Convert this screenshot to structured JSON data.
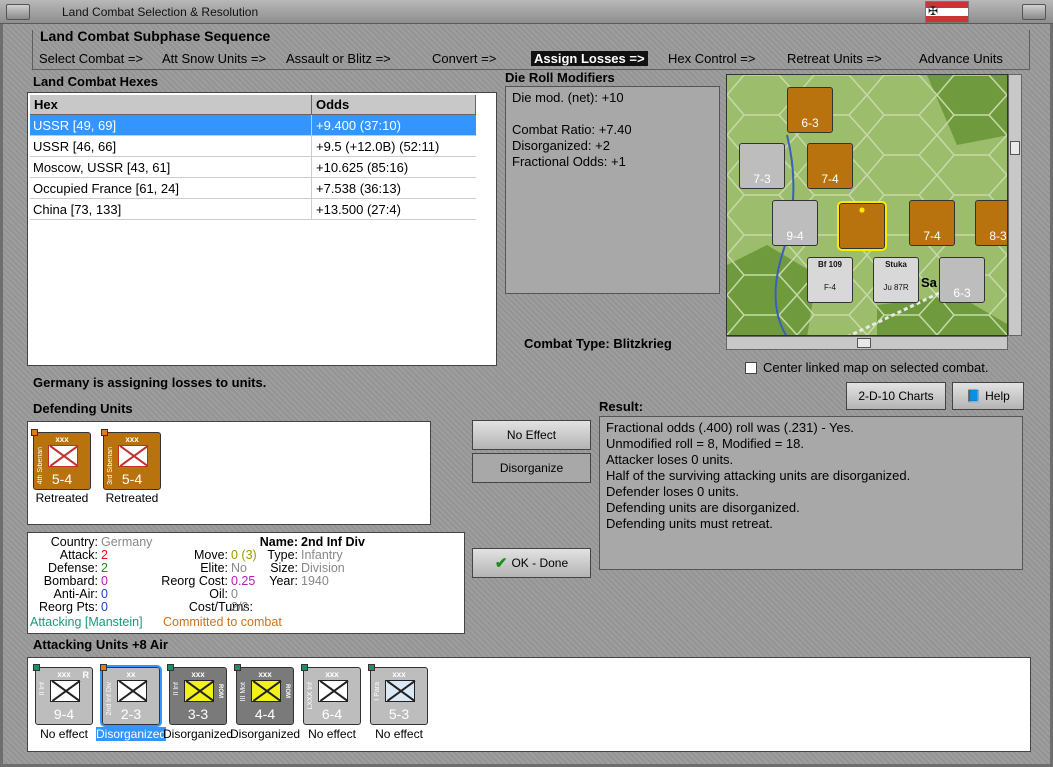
{
  "window": {
    "title": "Land Combat Selection & Resolution"
  },
  "sequence": {
    "title": "Land Combat Subphase Sequence",
    "steps": [
      "Select Combat =>",
      "Att Snow Units =>",
      "Assault or Blitz =>",
      "Convert =>",
      "Assign Losses =>",
      "Hex Control =>",
      "Retreat Units =>",
      "Advance Units"
    ],
    "active_index": 4
  },
  "hexes": {
    "label": "Land Combat Hexes",
    "columns": [
      "Hex",
      "Odds"
    ],
    "rows": [
      {
        "hex": "USSR [49, 69]",
        "odds": "+9.400 (37:10)"
      },
      {
        "hex": "USSR [46, 66]",
        "odds": "+9.5 (+12.0B) (52:11)"
      },
      {
        "hex": "Moscow, USSR [43, 61]",
        "odds": "+10.625 (85:16)"
      },
      {
        "hex": "Occupied France [61, 24]",
        "odds": "+7.538 (36:13)"
      },
      {
        "hex": "China [73, 133]",
        "odds": "+13.500 (27:4)"
      }
    ]
  },
  "die_roll": {
    "label": "Die Roll Modifiers",
    "lines": [
      "Die mod. (net): +10",
      "",
      "Combat Ratio: +7.40",
      "Disorganized: +2",
      "Fractional Odds: +1"
    ]
  },
  "combat_type": {
    "label": "Combat Type:",
    "value": "Blitzkrieg"
  },
  "map_option": {
    "label": "Center linked map on selected combat."
  },
  "buttons": {
    "charts": "2-D-10 Charts",
    "help": "Help",
    "no_effect": "No Effect",
    "disorganize": "Disorganize",
    "ok": "OK - Done"
  },
  "status_message": "Germany is assigning losses to units.",
  "defending": {
    "label": "Defending Units",
    "units": [
      {
        "size": "xxx",
        "name": "4th Siberian",
        "value": "5-4",
        "status": "Retreated"
      },
      {
        "size": "xxx",
        "name": "3rd Siberian",
        "value": "5-4",
        "status": "Retreated"
      }
    ]
  },
  "result": {
    "label": "Result:",
    "lines": [
      "Fractional odds (.400) roll was (.231)  - Yes.",
      "Unmodified roll = 8, Modified = 18.",
      "Attacker loses 0 units.",
      "Half of the surviving attacking units are disorganized.",
      "Defender loses 0 units.",
      "Defending units are disorganized.",
      "Defending units must retreat."
    ]
  },
  "unit_info": {
    "country_label": "Country:",
    "country": "Germany",
    "attack_label": "Attack:",
    "attack": "2",
    "defense_label": "Defense:",
    "defense": "2",
    "bombard_label": "Bombard:",
    "bombard": "0",
    "antiair_label": "Anti-Air:",
    "antiair": "0",
    "reorg_pts_label": "Reorg Pts:",
    "reorg_pts": "0",
    "name_label": "Name:",
    "name": "2nd Inf Div",
    "move_label": "Move:",
    "move": "0 (3)",
    "type_label": "Type:",
    "type": "Infantry",
    "elite_label": "Elite:",
    "elite": "No",
    "size_label": "Size:",
    "size": "Division",
    "reorg_cost_label": "Reorg Cost:",
    "reorg_cost": "0.25",
    "year_label": "Year:",
    "year": "1940",
    "oil_label": "Oil:",
    "oil": "0",
    "cost_label": "Cost/Turns:",
    "cost": "2/2",
    "attacking": "Attacking [Manstein]",
    "committed": "Committed to combat"
  },
  "attacking": {
    "label": "Attacking Units +8 Air",
    "units": [
      {
        "size": "xxx",
        "name": "II Inf",
        "value": "9-4",
        "tag": "R",
        "status": "No effect",
        "style": "grey"
      },
      {
        "size": "xx",
        "name": "2nd Inf Div",
        "value": "2-3",
        "tag": "",
        "status": "Disorganized",
        "style": "grey"
      },
      {
        "size": "xxx",
        "name": "II Inf",
        "value": "3-3",
        "tag": "ROM",
        "status": "Disorganized",
        "style": "dark"
      },
      {
        "size": "xxx",
        "name": "III Mot",
        "value": "4-4",
        "tag": "ROM",
        "status": "Disorganized",
        "style": "dark"
      },
      {
        "size": "xxx",
        "name": "LXXX Inf",
        "value": "6-4",
        "tag": "",
        "status": "No effect",
        "style": "grey"
      },
      {
        "size": "xxx",
        "name": "I Para",
        "value": "5-3",
        "tag": "",
        "status": "No effect",
        "style": "grey"
      }
    ]
  },
  "map_units": [
    {
      "num": "6-3"
    },
    {
      "num": "7-3"
    },
    {
      "num": "7-4"
    },
    {
      "num": "9-4"
    },
    {
      "num": "7-4"
    },
    {
      "num": "8-3"
    },
    {
      "num": "6-3"
    }
  ],
  "map_air": [
    {
      "label": "Bf 109",
      "sub": "F-4"
    },
    {
      "label": "Stuka",
      "sub": "Ju 87R"
    }
  ],
  "map_text": "Sa"
}
